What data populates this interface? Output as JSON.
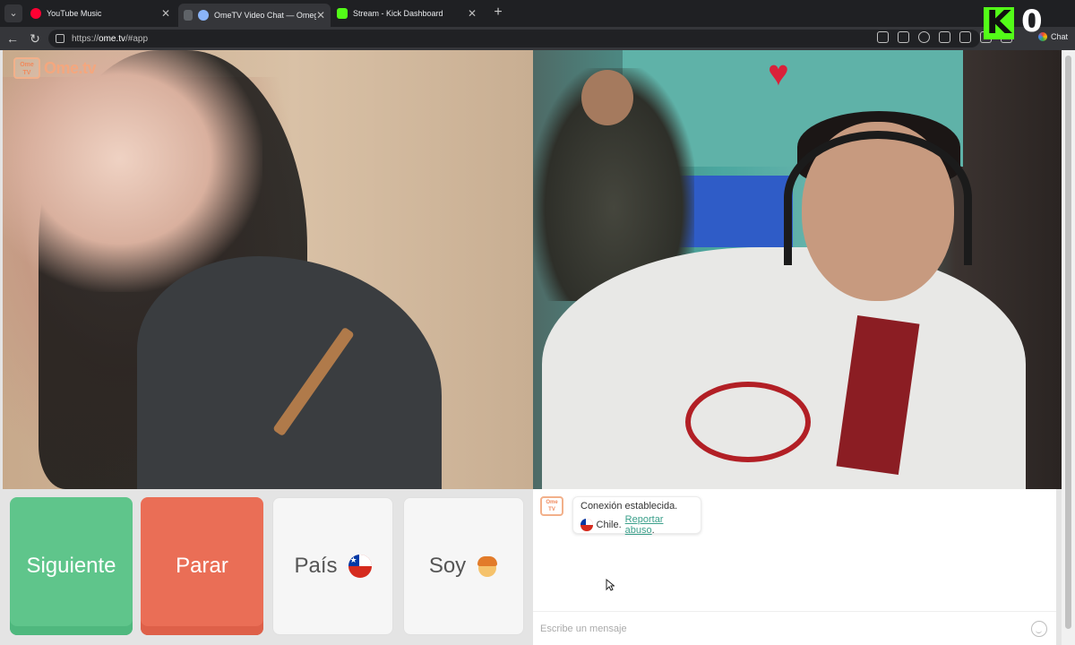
{
  "browser": {
    "tabs": [
      {
        "title": "YouTube Music",
        "color": "#ff0033"
      },
      {
        "title": "OmeTV Video Chat — Omegle alternative",
        "color": "#8ab4f8"
      },
      {
        "title": "Stream - Kick Dashboard",
        "color": "#53fc18"
      }
    ],
    "new_tab_glyph": "+",
    "close_glyph": "✕",
    "url_scheme": "https://",
    "url_host": "ome.tv",
    "url_path": "/#app",
    "chat_label": "Chat"
  },
  "kick_overlay": {
    "logo": "K",
    "count": "0",
    "color": "#53fc18"
  },
  "logo": {
    "badge": "Ome TV",
    "word": "Ome.tv"
  },
  "controls": {
    "next_label": "Siguiente",
    "stop_label": "Parar",
    "country_label": "País",
    "gender_label": "Soy",
    "next_color": "#5fc58b",
    "stop_color": "#ea6e56"
  },
  "chat": {
    "badge": "Ome TV",
    "connection_text": "Conexión establecida.",
    "country_text": "Chile.",
    "report_link": "Reportar abuso",
    "report_suffix": ".",
    "input_placeholder": "Escribe un mensaje"
  }
}
